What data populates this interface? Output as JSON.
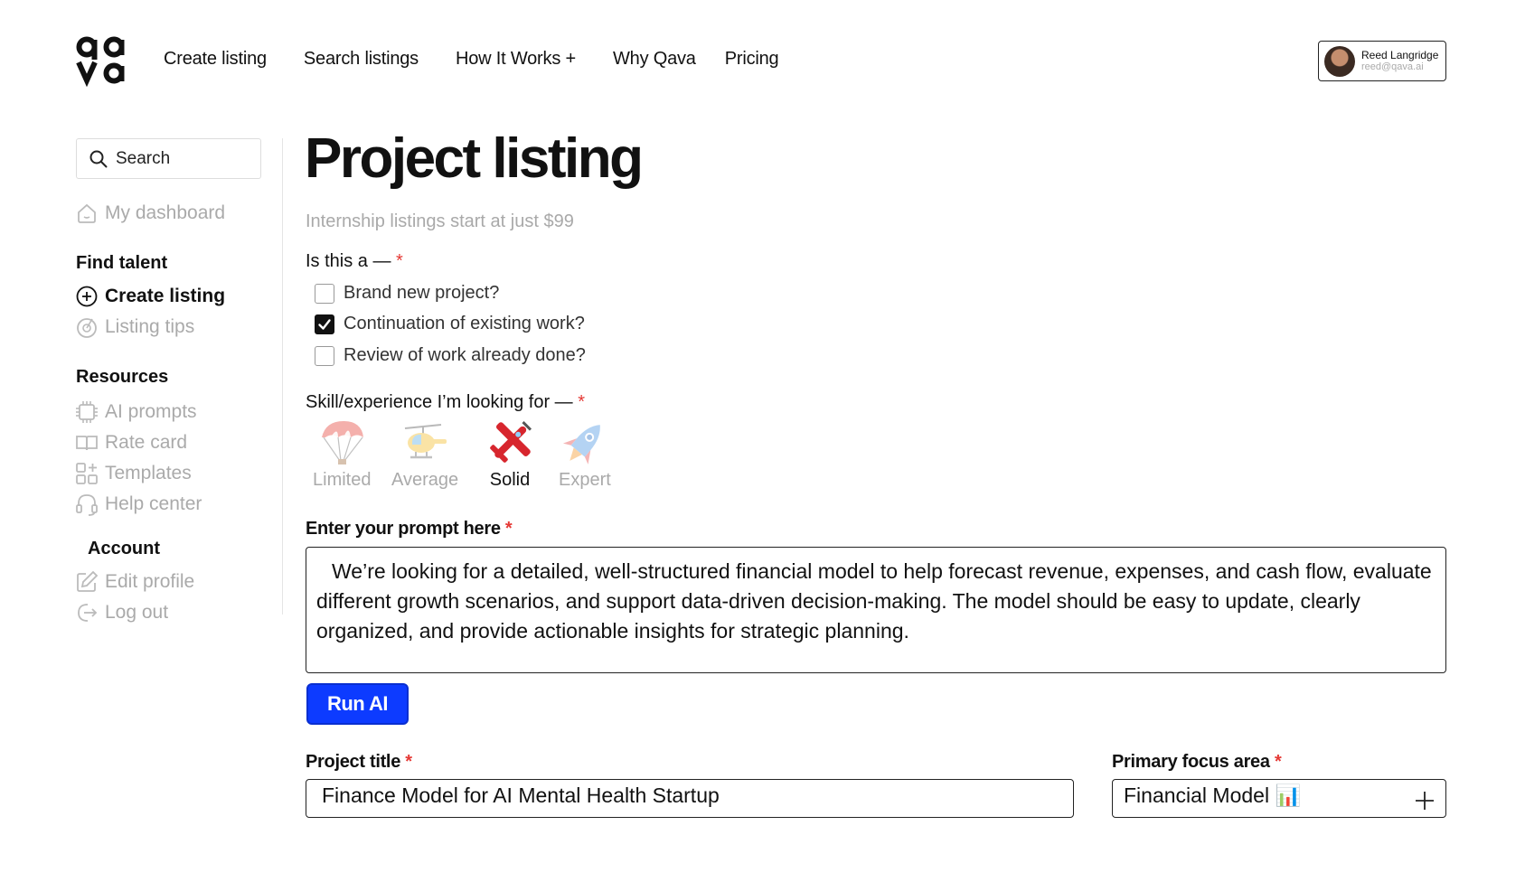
{
  "nav": {
    "links": [
      "Create listing",
      "Search listings",
      "How It Works +",
      "Why Qava",
      "Pricing"
    ]
  },
  "user": {
    "name": "Reed Langridge",
    "email": "reed@qava.ai"
  },
  "sidebar": {
    "search_label": "Search",
    "dashboard": "My dashboard",
    "find_talent_heading": "Find talent",
    "create_listing": "Create listing",
    "listing_tips": "Listing tips",
    "resources_heading": "Resources",
    "resources": [
      "AI prompts",
      "Rate card",
      "Templates",
      "Help center"
    ],
    "account_heading": "Account",
    "edit_profile": "Edit profile",
    "log_out": "Log out"
  },
  "main": {
    "title": "Project listing",
    "subtitle": "Internship listings start at just $99",
    "is_this_label": "Is this a —",
    "required_mark": "*",
    "options": [
      {
        "label": "Brand new project?",
        "checked": false
      },
      {
        "label": "Continuation of existing work?",
        "checked": true
      },
      {
        "label": "Review of work already done?",
        "checked": false
      }
    ],
    "skill_label": "Skill/experience I’m looking for —",
    "skills": [
      "Limited",
      "Average",
      "Solid",
      "Expert"
    ],
    "selected_skill": "Solid",
    "prompt_label": "Enter your prompt here",
    "prompt_line1": "We’re looking for a detailed, well-structured financial model to help forecast revenue, expenses, and cash flow, evaluate",
    "prompt_rest": "different growth scenarios, and support data-driven decision-making. The model should be easy to update, clearly organized, and provide actionable insights for strategic planning.",
    "run_button": "Run AI",
    "project_title_label": "Project title",
    "project_title_value": "Finance Model for AI Mental Health Startup",
    "focus_label": "Primary focus area",
    "focus_value": "Financial Model 📊"
  },
  "colors": {
    "accent": "#0d3bff",
    "required": "#e53935",
    "muted": "#aaaaaa"
  },
  "icons": [
    "search-icon",
    "home-icon",
    "plus-circle-icon",
    "target-icon",
    "chip-icon",
    "book-icon",
    "grid-icon",
    "headset-icon",
    "edit-icon",
    "logout-icon",
    "parachute-icon",
    "helicopter-icon",
    "airplane-icon",
    "rocket-icon",
    "plus-icon"
  ]
}
